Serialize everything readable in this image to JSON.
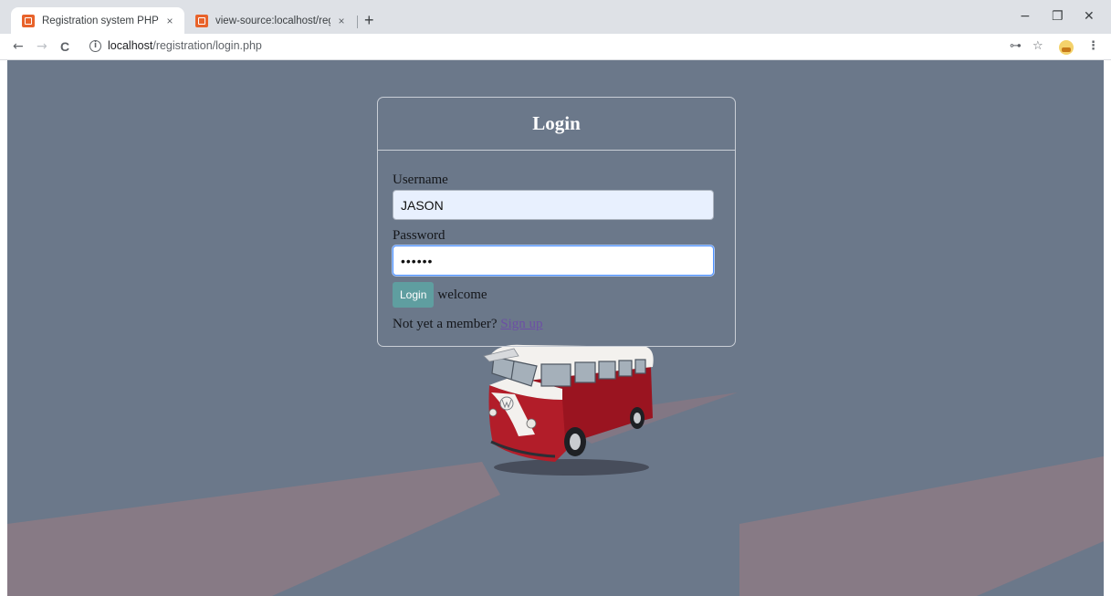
{
  "browser": {
    "tabs": [
      {
        "title": "Registration system PHP and My",
        "close": "×",
        "favicon_color": "#e8632b"
      },
      {
        "title": "view-source:localhost/registratio",
        "close": "×",
        "favicon_color": "#e8632b"
      }
    ],
    "new_tab": "+",
    "window_controls": {
      "minimize": "−",
      "maximize": "❐",
      "close": "✕"
    },
    "nav": {
      "back": "←",
      "forward": "→",
      "reload": "C"
    },
    "url": {
      "host": "localhost",
      "path": "/registration/login.php",
      "info_glyph": "i"
    },
    "toolbar_icons": {
      "key": "⊶",
      "star": "☆",
      "menu": "⋮"
    }
  },
  "page": {
    "background_color": "#6b788a",
    "title": "Login",
    "username": {
      "label": "Username",
      "value": "JASON"
    },
    "password": {
      "label": "Password",
      "value": "••••••"
    },
    "login_button": "Login",
    "welcome_text": "welcome",
    "signup_prompt": "Not yet a member?",
    "signup_link": "Sign up",
    "accent_color": "#5f9ea0",
    "link_color": "#6c4fa5"
  }
}
